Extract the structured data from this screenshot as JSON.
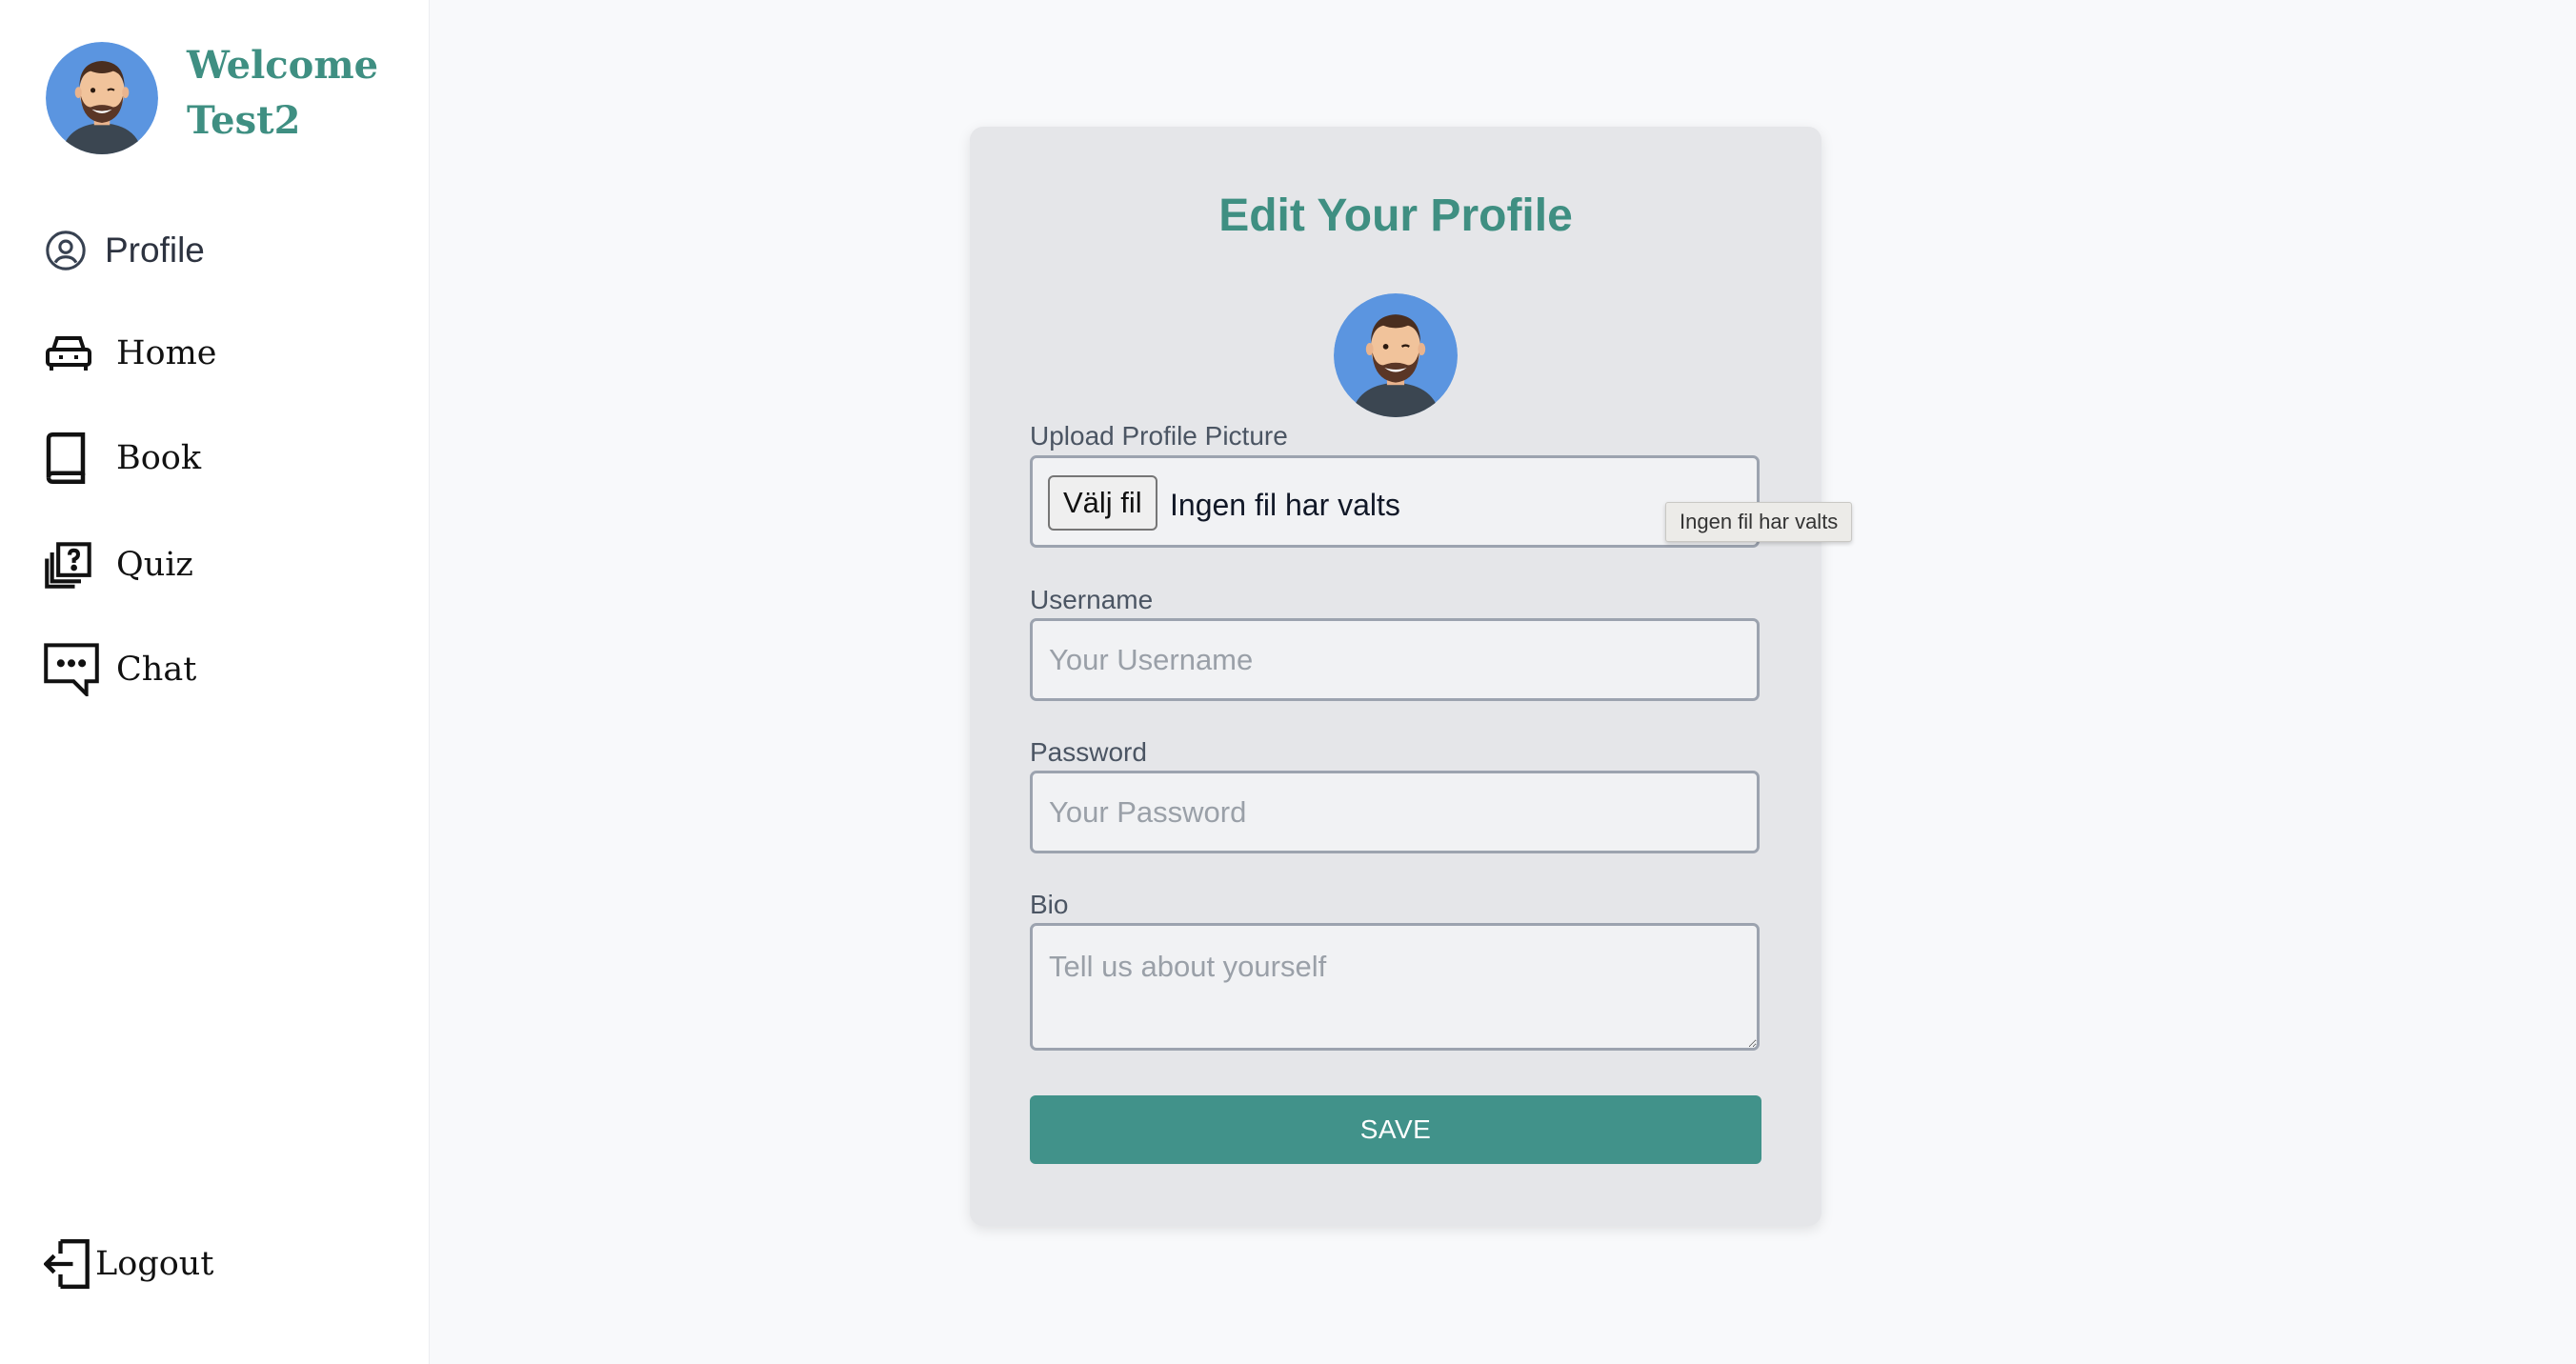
{
  "sidebar": {
    "welcome": "Welcome",
    "username": "Test2",
    "nav": [
      {
        "label": "Profile",
        "icon": "user-circle-icon"
      },
      {
        "label": "Home",
        "icon": "car-icon"
      },
      {
        "label": "Book",
        "icon": "book-icon"
      },
      {
        "label": "Quiz",
        "icon": "quiz-icon"
      },
      {
        "label": "Chat",
        "icon": "chat-icon"
      }
    ],
    "logout": {
      "label": "Logout",
      "icon": "logout-icon"
    }
  },
  "form": {
    "title": "Edit Your Profile",
    "upload_label": "Upload Profile Picture",
    "file_button": "Välj fil",
    "file_status": "Ingen fil har valts",
    "username_label": "Username",
    "username_placeholder": "Your Username",
    "password_label": "Password",
    "password_placeholder": "Your Password",
    "bio_label": "Bio",
    "bio_placeholder": "Tell us about yourself",
    "save_label": "SAVE"
  },
  "tooltip": {
    "text": "Ingen fil har valts"
  },
  "colors": {
    "accent": "#3f8f82",
    "button": "#41928a",
    "card": "#e5e6e9",
    "avatar_bg": "#5b95e0"
  }
}
